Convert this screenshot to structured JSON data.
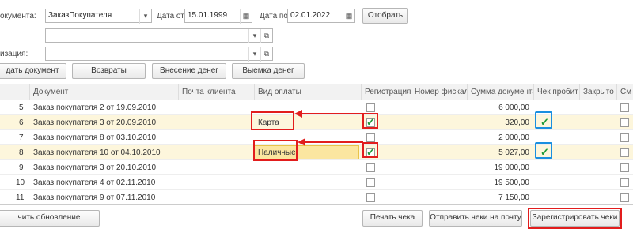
{
  "filters": {
    "doc_label": "окумента:",
    "doc_value": "ЗаказПокупателя",
    "date_from_label": "Дата от:",
    "date_from": "15.01.1999",
    "date_to_label": "Дата по:",
    "date_to": "02.01.2022",
    "select_btn": "Отобрать",
    "org_label": "изация:"
  },
  "toolbar": {
    "add_doc": "дать документ",
    "returns": "Возвраты",
    "cash_in": "Внесение денег",
    "cash_out": "Выемка денег"
  },
  "table": {
    "columns": [
      "Документ",
      "Почта клиента",
      "Вид оплаты",
      "Регистрация",
      "Номер фискал",
      "Сумма документа",
      "Чек пробит",
      "Закрыто",
      "См"
    ],
    "rows": [
      {
        "n": "5",
        "doc": "Заказ покупателя 2 от 19.09.2010",
        "email": "",
        "pay": "",
        "reg": false,
        "sum": "6 000,00",
        "printed": false
      },
      {
        "n": "6",
        "doc": "Заказ покупателя 3 от 20.09.2010",
        "email": "",
        "pay": "Карта",
        "reg": true,
        "sum": "320,00",
        "printed": true
      },
      {
        "n": "7",
        "doc": "Заказ покупателя 8 от 03.10.2010",
        "email": "",
        "pay": "",
        "reg": false,
        "sum": "2 000,00",
        "printed": false
      },
      {
        "n": "8",
        "doc": "Заказ покупателя 10 от 04.10.2010",
        "email": "",
        "pay": "Наличные",
        "reg": true,
        "sum": "5 027,00",
        "printed": true
      },
      {
        "n": "9",
        "doc": "Заказ покупателя 3 от 20.10.2010",
        "email": "",
        "pay": "",
        "reg": false,
        "sum": "19 000,00",
        "printed": false
      },
      {
        "n": "10",
        "doc": "Заказ покупателя 4 от 02.11.2010",
        "email": "",
        "pay": "",
        "reg": false,
        "sum": "19 500,00",
        "printed": false
      },
      {
        "n": "11",
        "doc": "Заказ покупателя 9 от 07.11.2010",
        "email": "",
        "pay": "",
        "reg": false,
        "sum": "7 150,00",
        "printed": false
      }
    ]
  },
  "bottom": {
    "update": "чить обновление",
    "print": "Печать чека",
    "send": "Отправить чеки на почту",
    "register": "Зарегистрировать чеки"
  },
  "colors": {
    "highlight_row": "#fdf6dc",
    "annotation_red": "#e21d1d",
    "annotation_blue": "#1a8fe0",
    "check_green": "#1e9a38"
  }
}
